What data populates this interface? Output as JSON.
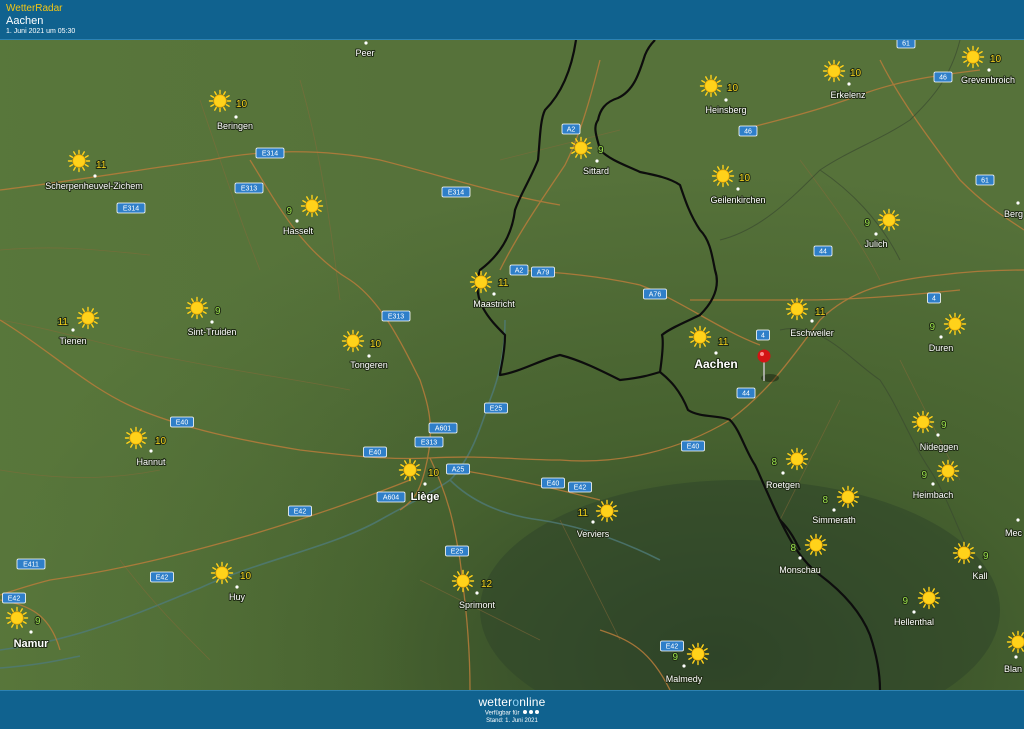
{
  "header": {
    "app_title": "WetterRadar",
    "location": "Aachen",
    "timestamp": "1. Juni 2021 um 05:30"
  },
  "footer": {
    "logo_left": "wetter",
    "logo_o": "o",
    "logo_right": "nline",
    "availability_label": "Verfügbar für",
    "stand": "Stand: 1. Juni 2021"
  },
  "colors": {
    "header_bg": "#10628f",
    "brand_yellow": "#f3c614",
    "temp_yellow": "#f5d31c",
    "temp_green": "#9ae04a",
    "road_sign": "#2f7fc9",
    "pin": "#d31414"
  },
  "weather_icon": "sun-icon",
  "cities": [
    {
      "id": "peer",
      "name": "Peer"
    },
    {
      "id": "beringen",
      "name": "Beringen",
      "temp": "10"
    },
    {
      "id": "scherpenheuvel",
      "name": "Scherpenheuvel-Zichem",
      "temp": "11"
    },
    {
      "id": "hasselt",
      "name": "Hasselt",
      "temp": "9"
    },
    {
      "id": "sint-truiden",
      "name": "Sint-Truiden",
      "temp": "9"
    },
    {
      "id": "tienen",
      "name": "Tienen",
      "temp": "11"
    },
    {
      "id": "tongeren",
      "name": "Tongeren",
      "temp": "10"
    },
    {
      "id": "maastricht",
      "name": "Maastricht",
      "temp": "11"
    },
    {
      "id": "sittard",
      "name": "Sittard",
      "temp": "9"
    },
    {
      "id": "heinsberg",
      "name": "Heinsberg",
      "temp": "10"
    },
    {
      "id": "erkelenz",
      "name": "Erkelenz",
      "temp": "10"
    },
    {
      "id": "grevenbroich",
      "name": "Grevenbroich",
      "temp": "10"
    },
    {
      "id": "geilenkirchen",
      "name": "Geilenkirchen",
      "temp": "10"
    },
    {
      "id": "julich",
      "name": "Julich",
      "temp": "9"
    },
    {
      "id": "berg",
      "name": "Berg"
    },
    {
      "id": "eschweiler",
      "name": "Eschweiler",
      "temp": "11"
    },
    {
      "id": "aachen",
      "name": "Aachen",
      "temp": "11"
    },
    {
      "id": "duren",
      "name": "Duren",
      "temp": "9"
    },
    {
      "id": "hannut",
      "name": "Hannut",
      "temp": "10"
    },
    {
      "id": "liege",
      "name": "Liège",
      "temp": "10"
    },
    {
      "id": "nideggen",
      "name": "Nideggen",
      "temp": "9"
    },
    {
      "id": "roetgen",
      "name": "Roetgen",
      "temp": "8"
    },
    {
      "id": "heimbach",
      "name": "Heimbach",
      "temp": "9"
    },
    {
      "id": "simmerath",
      "name": "Simmerath",
      "temp": "8"
    },
    {
      "id": "verviers",
      "name": "Verviers",
      "temp": "11"
    },
    {
      "id": "mec",
      "name": "Mec"
    },
    {
      "id": "monschau",
      "name": "Monschau",
      "temp": "8"
    },
    {
      "id": "kall",
      "name": "Kall",
      "temp": "9"
    },
    {
      "id": "huy",
      "name": "Huy",
      "temp": "10"
    },
    {
      "id": "sprimont",
      "name": "Sprimont",
      "temp": "12"
    },
    {
      "id": "namur",
      "name": "Namur",
      "temp": "9"
    },
    {
      "id": "hellenthal",
      "name": "Hellenthal",
      "temp": "9"
    },
    {
      "id": "malmedy",
      "name": "Malmedy",
      "temp": "9"
    },
    {
      "id": "blan",
      "name": "Blan"
    }
  ],
  "road_signs": [
    "61",
    "46",
    "46",
    "61",
    "44",
    "4",
    "4",
    "44",
    "A2",
    "A2",
    "A79",
    "A76",
    "E314",
    "E313",
    "E314",
    "E314",
    "E313",
    "E25",
    "A601",
    "E313",
    "E40",
    "E40",
    "E40",
    "A25",
    "A604",
    "E42",
    "E40",
    "E42",
    "E25",
    "E411",
    "E42",
    "E42",
    "E42"
  ]
}
